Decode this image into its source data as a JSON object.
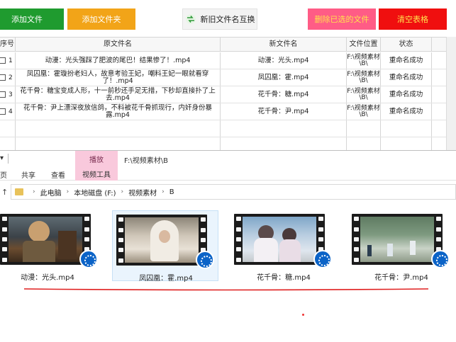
{
  "toolbar": {
    "add_file": "添加文件",
    "add_folder": "添加文件夹",
    "swap": "新旧文件名互换",
    "delete_selected": "删除已选的文件",
    "clear_table": "清空表格"
  },
  "table": {
    "headers": {
      "no": "序号",
      "original": "原文件名",
      "new": "新文件名",
      "location": "文件位置",
      "status": "状态"
    },
    "rows": [
      {
        "no": "1",
        "original": "动漫：光头强踩了肥波的尾巴！结果惨了！.mp4",
        "new": "动漫：光头.mp4",
        "location": "F:\\视频素材\\B\\",
        "status": "重命名成功"
      },
      {
        "no": "2",
        "original": "凤囚凰：霍璇扮老妇人，故意考验王妃，嘲料王妃一眼就看穿了！.mp4",
        "new": "凤囚凰：霍.mp4",
        "location": "F:\\视频素材\\B\\",
        "status": "重命名成功"
      },
      {
        "no": "3",
        "original": "花千骨：糖宝变成人形，十一前秒还手足无措，下秒却直接扑了上去.mp4",
        "new": "花千骨：糖.mp4",
        "location": "F:\\视频素材\\B\\",
        "status": "重命名成功"
      },
      {
        "no": "4",
        "original": "花千骨：尹上漂深夜放信鸽，不料被花千骨抓现行，内奸身份暴露.mp4",
        "new": "花千骨：尹.mp4",
        "location": "F:\\视频素材\\B\\",
        "status": "重命名成功"
      }
    ]
  },
  "explorer": {
    "tool_header": "播放",
    "window_path": "F:\\视频素材\\B",
    "ribbon_tabs": [
      "页",
      "共享",
      "查看",
      "视频工具"
    ],
    "breadcrumb": [
      "此电脑",
      "本地磁盘 (F:)",
      "视频素材",
      "B"
    ],
    "files": [
      {
        "name": "动漫：光头.mp4"
      },
      {
        "name": "凤囚凰：霍.mp4"
      },
      {
        "name": "花千骨：糖.mp4"
      },
      {
        "name": "花千骨：尹.mp4"
      }
    ]
  },
  "colors": {
    "add_file": "#1f9b2f",
    "add_folder": "#f2a418",
    "delete": "#ff5c86",
    "clear": "#f00f0f",
    "tool_tab": "#f9c9dc",
    "underline": "#e02020"
  }
}
